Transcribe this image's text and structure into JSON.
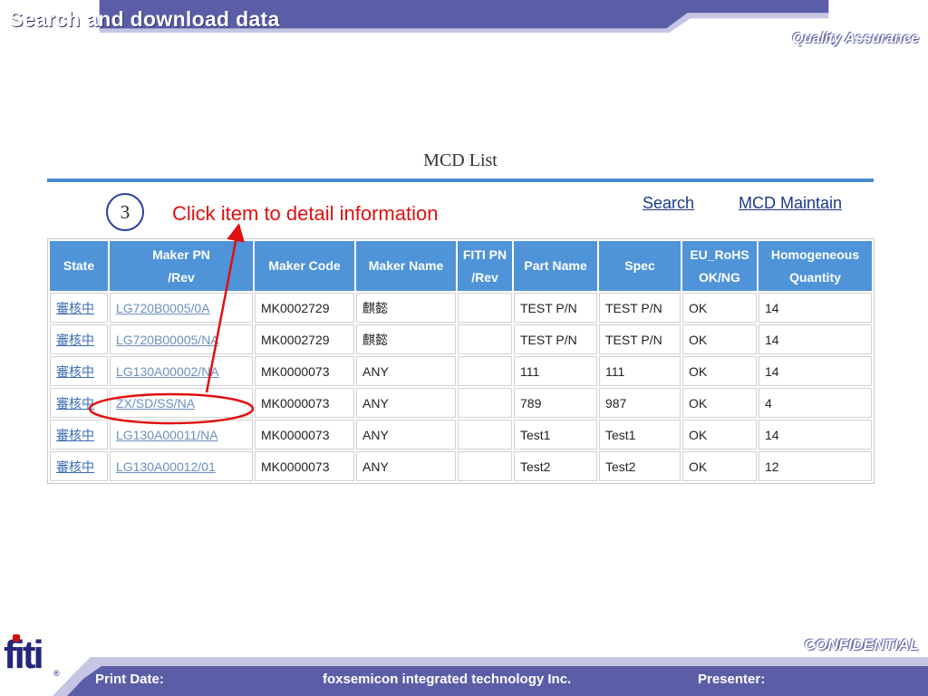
{
  "header": {
    "title": "Search and download data",
    "subtitle": "Quality Assurance"
  },
  "page": {
    "title": "MCD List",
    "step_number": "3",
    "instruction": "Click item to detail information",
    "links": {
      "search": "Search",
      "mcd_maintain": "MCD Maintain"
    }
  },
  "table": {
    "headers": [
      [
        "State"
      ],
      [
        "Maker PN",
        "/Rev"
      ],
      [
        "Maker Code"
      ],
      [
        "Maker Name"
      ],
      [
        "FITI PN",
        "/Rev"
      ],
      [
        "Part Name"
      ],
      [
        "Spec"
      ],
      [
        "EU_RoHS",
        "OK/NG"
      ],
      [
        "Homogeneous",
        "Quantity"
      ]
    ],
    "rows": [
      {
        "state": "審核中",
        "maker_pn": "LG720B0005/0A",
        "maker_code": "MK0002729",
        "maker_name": "麒懿",
        "fiti_pn": "",
        "part_name": "TEST P/N",
        "spec": "TEST P/N",
        "rohs": "OK",
        "quantity": "14"
      },
      {
        "state": "審核中",
        "maker_pn": "LG720B00005/NA",
        "maker_code": "MK0002729",
        "maker_name": "麒懿",
        "fiti_pn": "",
        "part_name": "TEST P/N",
        "spec": "TEST P/N",
        "rohs": "OK",
        "quantity": "14"
      },
      {
        "state": "審核中",
        "maker_pn": "LG130A00002/NA",
        "maker_code": "MK0000073",
        "maker_name": "ANY",
        "fiti_pn": "",
        "part_name": "111",
        "spec": "111",
        "rohs": "OK",
        "quantity": "14"
      },
      {
        "state": "審核中",
        "maker_pn": "ZX/SD/SS/NA",
        "maker_code": "MK0000073",
        "maker_name": "ANY",
        "fiti_pn": "",
        "part_name": "789",
        "spec": "987",
        "rohs": "OK",
        "quantity": "4"
      },
      {
        "state": "審核中",
        "maker_pn": "LG130A00011/NA",
        "maker_code": "MK0000073",
        "maker_name": "ANY",
        "fiti_pn": "",
        "part_name": "Test1",
        "spec": "Test1",
        "rohs": "OK",
        "quantity": "14"
      },
      {
        "state": "審核中",
        "maker_pn": "LG130A00012/01",
        "maker_code": "MK0000073",
        "maker_name": "ANY",
        "fiti_pn": "",
        "part_name": "Test2",
        "spec": "Test2",
        "rohs": "OK",
        "quantity": "12"
      }
    ]
  },
  "footer": {
    "confidential": "CONFIDENTIAL",
    "print_date_label": "Print Date:",
    "company": "foxsemicon integrated technology Inc.",
    "presenter_label": "Presenter:",
    "logo_text": "fiti",
    "logo_mark": "®"
  },
  "colors": {
    "band_dark": "#5b5ea6",
    "band_light": "#c4c6e3",
    "table_header": "#4f93d8",
    "annotation_red": "#e01010",
    "logo_navy": "#25277a"
  },
  "icons": [
    "step-number-circle",
    "annotation-arrow",
    "annotation-ellipse",
    "fiti-logo"
  ]
}
